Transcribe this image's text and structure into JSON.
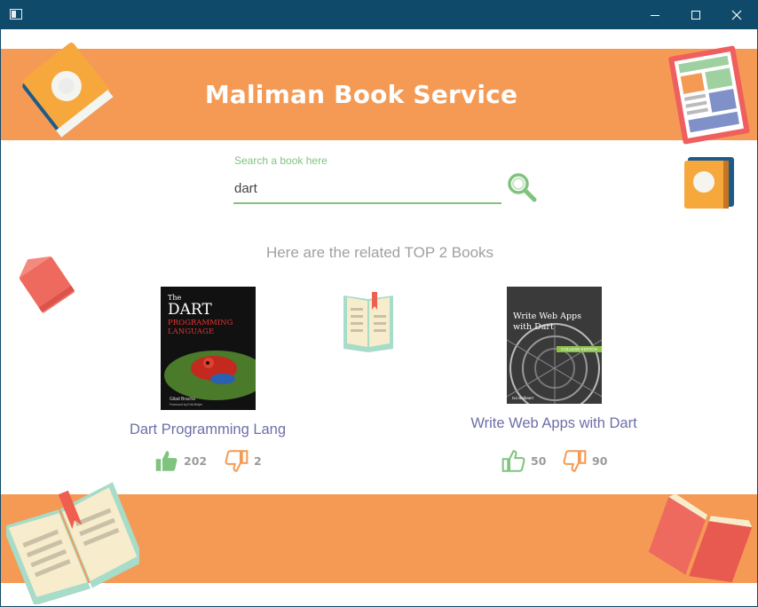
{
  "window": {
    "title": ""
  },
  "header": {
    "title": "Maliman Book Service"
  },
  "search": {
    "label": "Search a book here",
    "value": "dart",
    "placeholder": ""
  },
  "results": {
    "heading": "Here are the related TOP 2 Books",
    "books": [
      {
        "title": "Dart Programming Lang",
        "cover_text": [
          "The",
          "DART",
          "PROGRAMMING",
          "LANGUAGE",
          "Gilad Bracha",
          "Foreword by Erik Meijer"
        ],
        "likes": "202",
        "dislikes": "2"
      },
      {
        "title": "Write Web Apps with Dart",
        "cover_text": [
          "Write Web Apps",
          "with Dart",
          "COLLEGE EDITION",
          "Ivo Balbaert"
        ],
        "likes": "50",
        "dislikes": "90"
      }
    ]
  },
  "colors": {
    "titlebar": "#0f4a6a",
    "band": "#f49a55",
    "accent_green": "#80c37e",
    "dislike_orange": "#f49a55",
    "title_purple": "#6e6ea8"
  }
}
